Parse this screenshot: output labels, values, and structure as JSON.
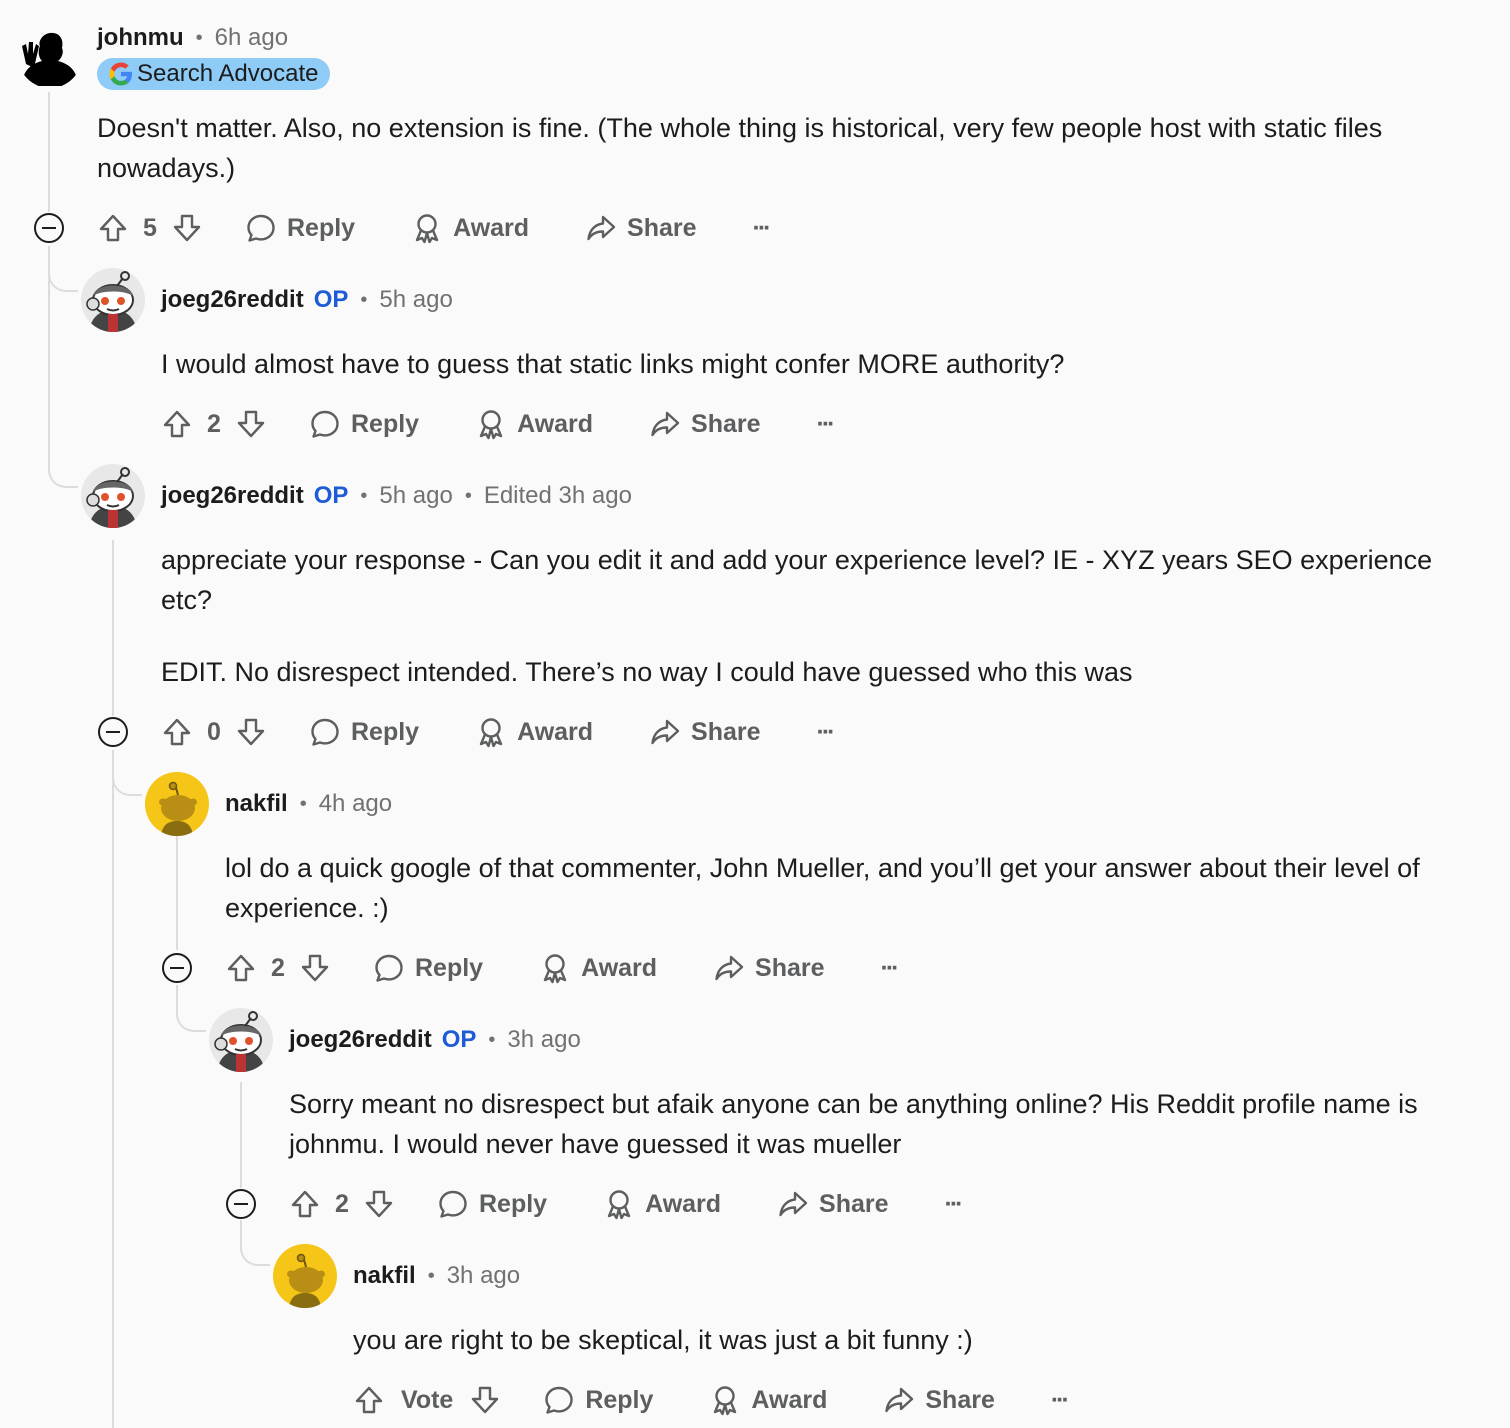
{
  "comments": [
    {
      "author": "johnmu",
      "time": "6h ago",
      "flair": "Search Advocate",
      "body": [
        "Doesn't matter. Also, no extension is fine. (The whole thing is historical, very few people host with static files nowadays.)"
      ],
      "score": "5"
    },
    {
      "author": "joeg26reddit",
      "op": "OP",
      "time": "5h ago",
      "body": [
        "I would almost have to guess that static links might confer MORE authority?"
      ],
      "score": "2"
    },
    {
      "author": "joeg26reddit",
      "op": "OP",
      "time": "5h ago",
      "edited": "Edited 3h ago",
      "body": [
        "appreciate your response - Can you edit it and add your experience level? IE - XYZ years SEO experience etc?",
        "EDIT. No disrespect intended. There’s no way I could have guessed who this was"
      ],
      "score": "0"
    },
    {
      "author": "nakfil",
      "time": "4h ago",
      "body": [
        "lol do a quick google of that commenter, John Mueller, and you’ll get your answer about their level of experience. :)"
      ],
      "score": "2"
    },
    {
      "author": "joeg26reddit",
      "op": "OP",
      "time": "3h ago",
      "body": [
        "Sorry meant no disrespect but afaik anyone can be anything online? His Reddit profile name is johnmu. I would never have guessed it was mueller"
      ],
      "score": "2"
    },
    {
      "author": "nakfil",
      "time": "3h ago",
      "body": [
        "you are right to be skeptical, it was just a bit funny :)"
      ],
      "score": "Vote"
    }
  ],
  "actions": {
    "reply": "Reply",
    "award": "Award",
    "share": "Share",
    "more": "···"
  },
  "dot": "•",
  "icons": [
    "upvote-icon",
    "downvote-icon",
    "reply-icon",
    "award-icon",
    "share-icon",
    "more-icon",
    "collapse-icon"
  ],
  "colors": {
    "op": "#1e5bd6",
    "flair_bg": "#8ecbf7",
    "nakfil_avatar": "#f5c518",
    "thread_line": "#dcdcdc"
  }
}
